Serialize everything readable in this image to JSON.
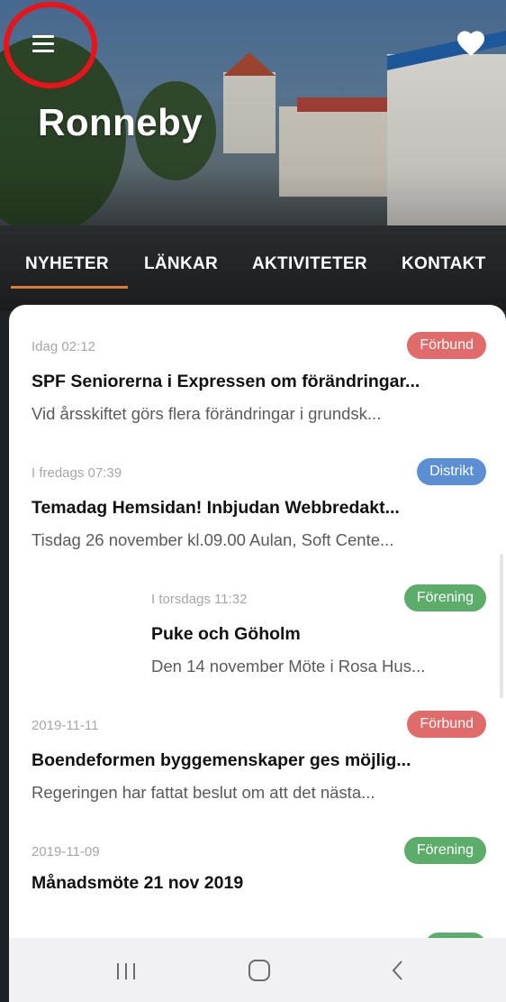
{
  "app": {
    "title": "Ronneby"
  },
  "tabs": [
    {
      "label": "NYHETER"
    },
    {
      "label": "LÄNKAR"
    },
    {
      "label": "AKTIVITETER"
    },
    {
      "label": "KONTAKT"
    }
  ],
  "news": [
    {
      "time": "Idag 02:12",
      "badge": "Förbund",
      "title": "SPF Seniorerna i Expressen om förändringar...",
      "summary": "Vid årsskiftet görs flera förändringar i grundsk..."
    },
    {
      "time": "I fredags 07:39",
      "badge": "Distrikt",
      "title": "Temadag Hemsidan! Inbjudan Webbredakt...",
      "summary": "Tisdag 26 november kl.09.00 Aulan, Soft Cente..."
    },
    {
      "time": "I torsdags 11:32",
      "badge": "Förening",
      "title": "Puke och Göholm",
      "summary": "Den 14 november Möte i Rosa Hus..."
    },
    {
      "time": "2019-11-11",
      "badge": "Förbund",
      "title": "Boendeformen byggemenskaper ges möjlig...",
      "summary": "Regeringen har fattat beslut om att det nästa..."
    },
    {
      "time": "2019-11-09",
      "badge": "Förening",
      "title": "Månadsmöte 21 nov 2019",
      "summary": ""
    }
  ],
  "colors": {
    "forbund": "#e06b6b",
    "distrikt": "#5b8fd4",
    "forening": "#5cad6a",
    "tab_indicator": "#e07a3a",
    "highlight_ring": "#e8141a"
  },
  "icons": {
    "menu": "hamburger-menu-icon",
    "favorite": "heart-icon",
    "nav_recents": "recent-apps-icon",
    "nav_home": "home-icon",
    "nav_back": "back-icon"
  }
}
